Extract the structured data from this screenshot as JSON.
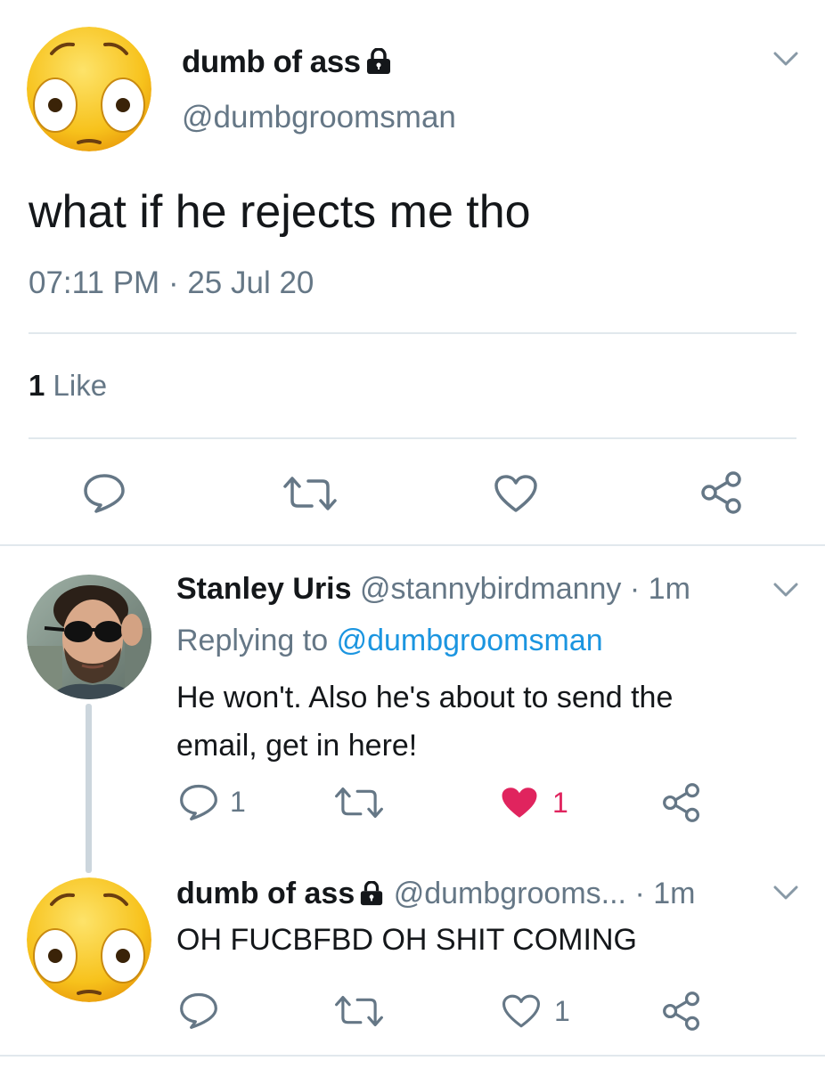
{
  "main_tweet": {
    "display_name": "dumb of ass",
    "handle": "@dumbgroomsman",
    "text": "what if he rejects me tho",
    "time": "07:11 PM",
    "dot": "·",
    "date": "25 Jul 20",
    "likes_count": "1",
    "likes_label": "Like"
  },
  "reply1": {
    "display_name": "Stanley Uris",
    "handle": "@stannybirdmanny",
    "dot": "·",
    "time": "1m",
    "replying_prefix": "Replying to",
    "replying_handle": "@dumbgroomsman",
    "text_line1": "He won't. Also he's about to send the",
    "text_line2": "email, get in here!",
    "reply_count": "1",
    "like_count": "1",
    "liked": true,
    "like_color": "#e0245e"
  },
  "reply2": {
    "display_name": "dumb of ass",
    "handle": "@dumbgrooms...",
    "dot": "·",
    "time": "1m",
    "text": "OH FUCBFBD OH SHIT COMING",
    "like_count": "1"
  },
  "colors": {
    "text": "#14171a",
    "muted": "#657786",
    "link": "#1b95e0",
    "divider": "#e1e8ed",
    "thread_line": "#ccd6dd"
  }
}
